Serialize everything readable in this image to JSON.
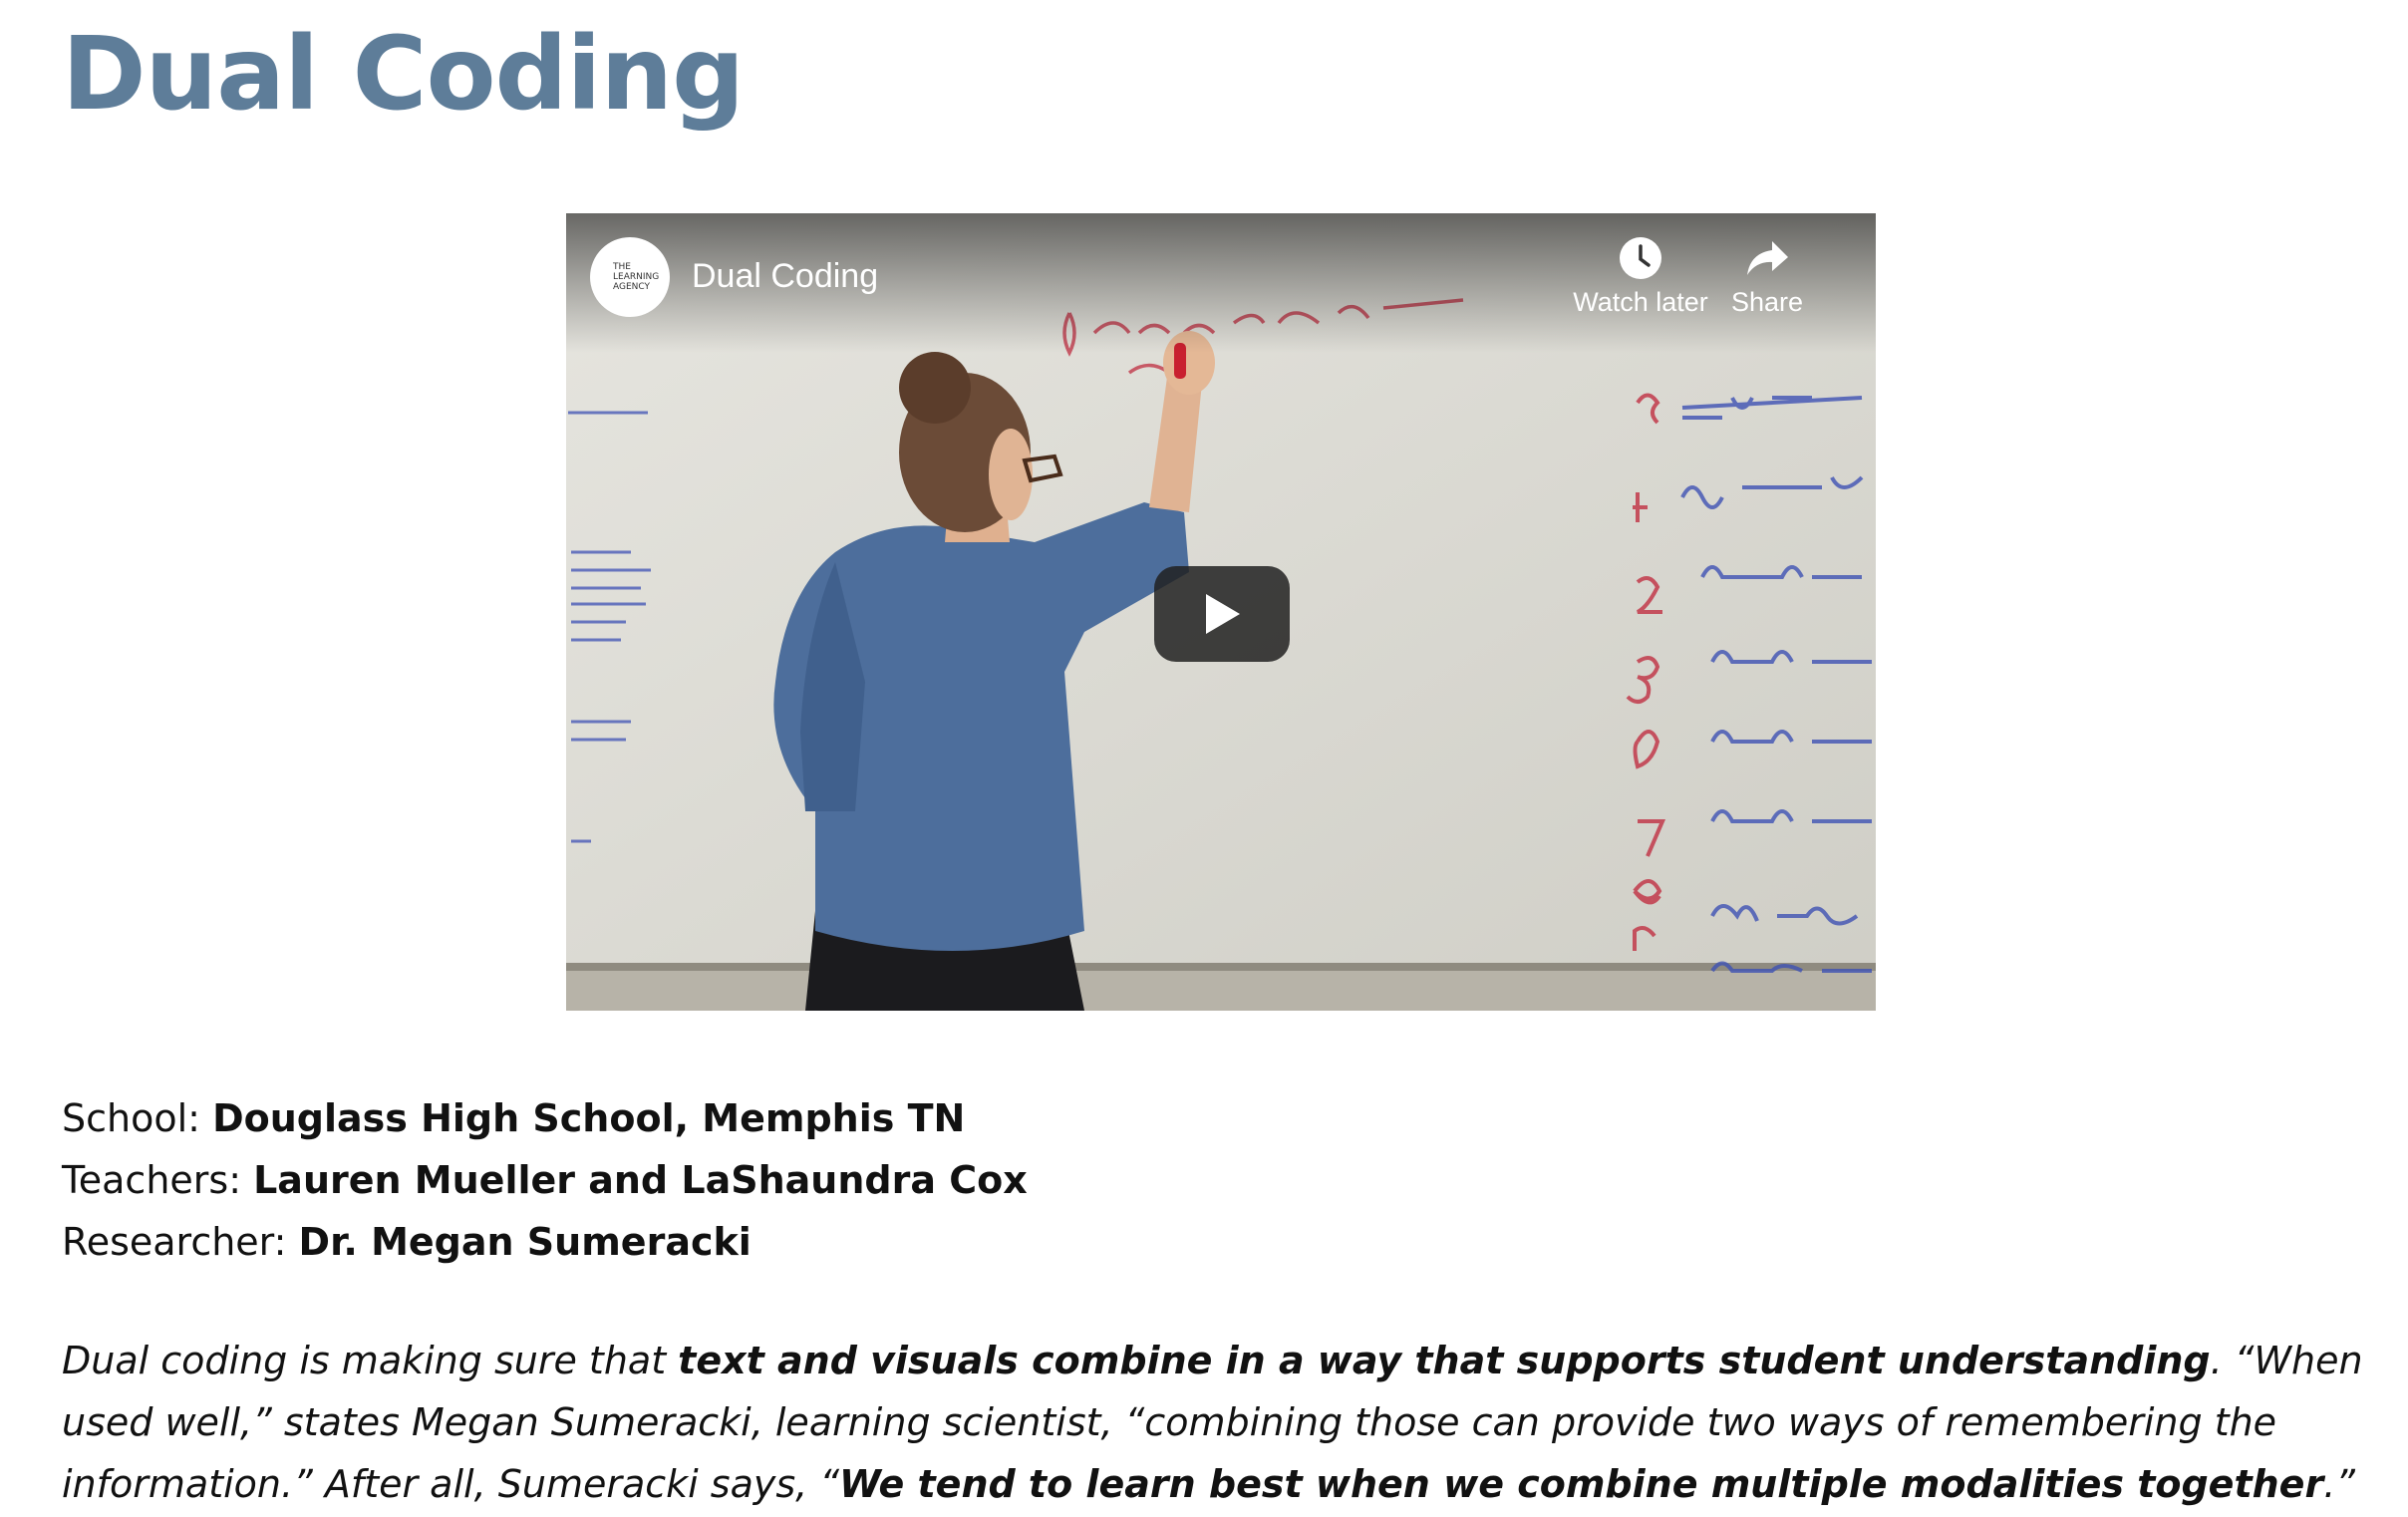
{
  "page": {
    "title": "Dual Coding"
  },
  "video": {
    "title": "Dual Coding",
    "channel_logo_text": "THE\nLEARNING\nAGENCY",
    "watch_later_label": "Watch later",
    "share_label": "Share",
    "play_icon": "play-icon",
    "watch_later_icon": "clock-icon",
    "share_icon": "share-arrow-icon"
  },
  "details": {
    "school_label": "School:",
    "school_value": "Douglass High School, Memphis TN",
    "teachers_label": "Teachers:",
    "teachers_value": "Lauren Mueller and LaShaundra Cox",
    "researcher_label": "Researcher:",
    "researcher_value": "Dr. Megan Sumeracki"
  },
  "quote": {
    "part1": "Dual coding is making sure that ",
    "bold1": "text and visuals combine in a way that supports student understanding",
    "part2": ". “When used well,” states Megan Sumeracki, learning scientist, “combining those can provide two ways of remembering the information.” After all, Sumeracki says, “",
    "bold2": "We tend to learn best when we combine multiple modalities together",
    "part3": ".”"
  },
  "colors": {
    "title": "#5e7d99",
    "text": "#111111",
    "player_overlay": "#212121"
  }
}
